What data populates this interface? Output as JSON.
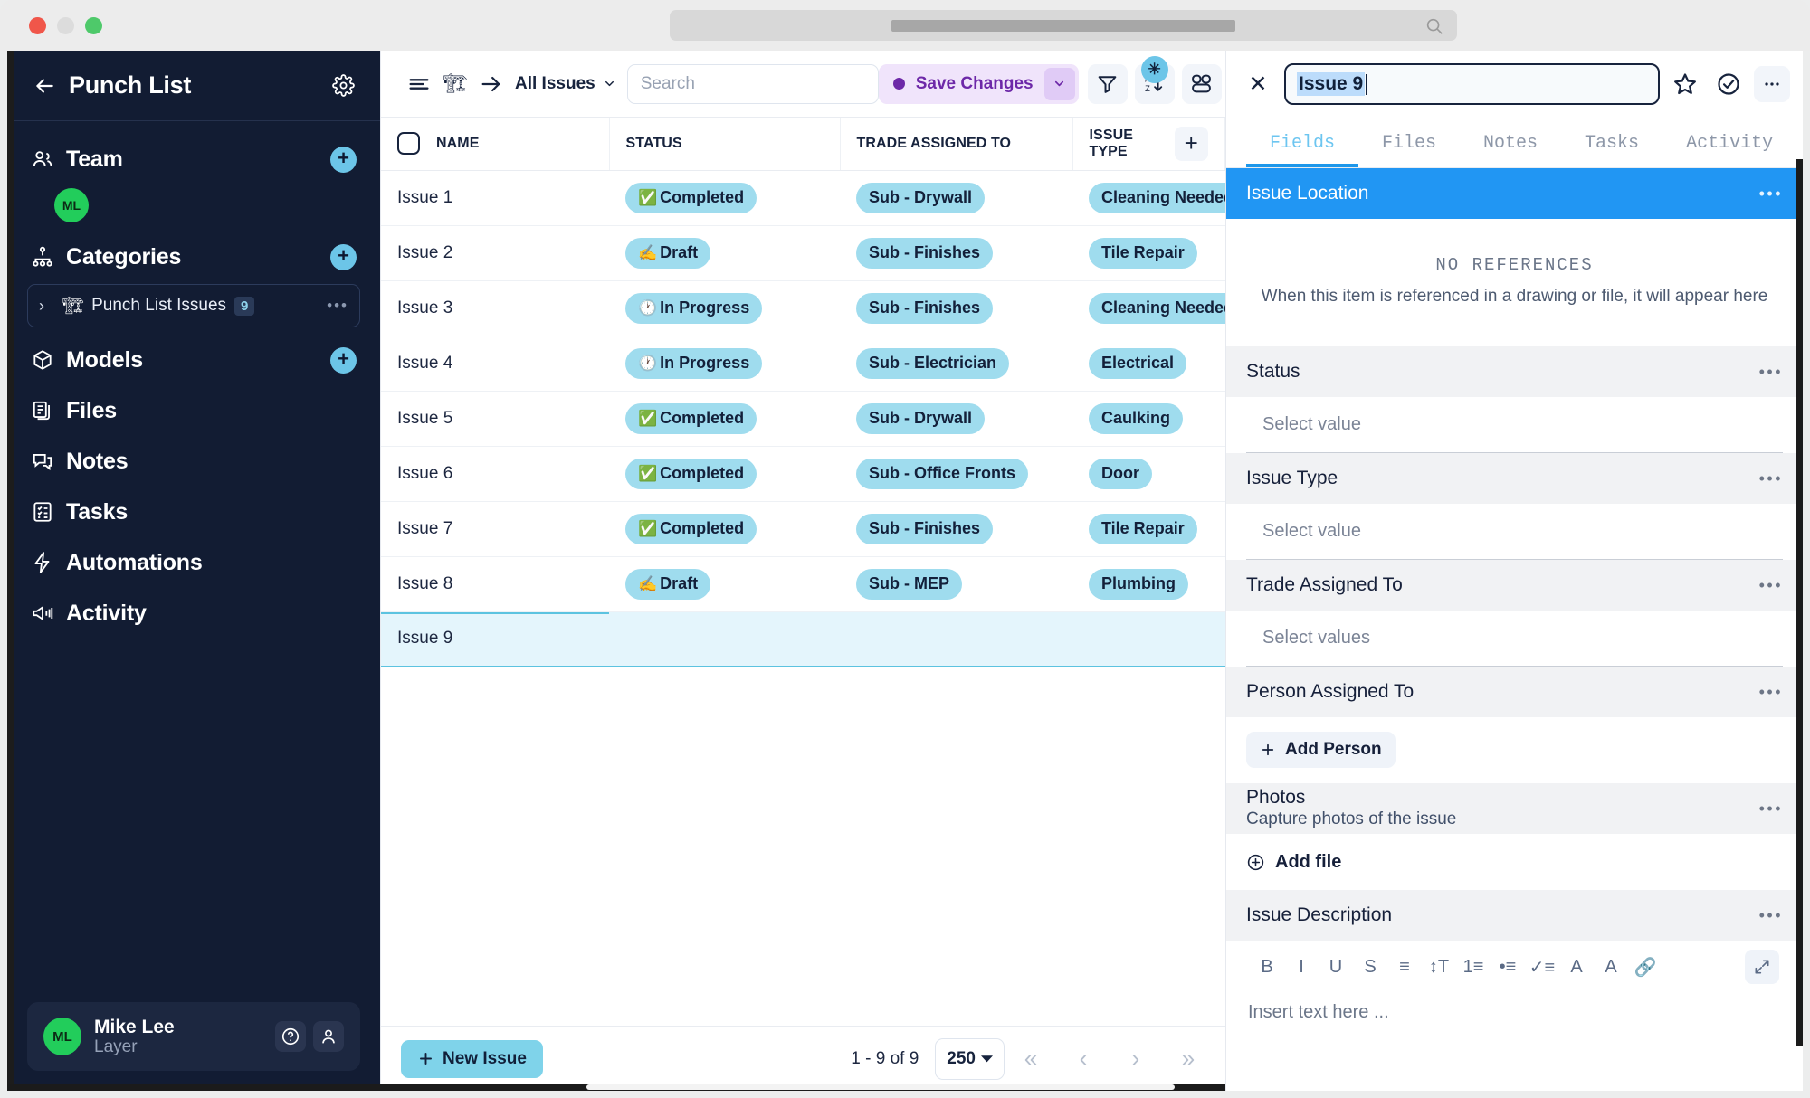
{
  "window": {
    "traffic_lights": [
      "close",
      "minimize",
      "maximize"
    ],
    "omnibox_placeholder": ""
  },
  "sidebar": {
    "back_icon": "arrow-left-icon",
    "title": "Punch List",
    "settings_icon": "gear-icon",
    "sections": [
      {
        "label": "Team",
        "icon": "people-icon",
        "has_add": true
      },
      {
        "label": "Categories",
        "icon": "hierarchy-icon",
        "has_add": true
      },
      {
        "label": "Models",
        "icon": "cube-icon",
        "has_add": true
      },
      {
        "label": "Files",
        "icon": "files-icon",
        "has_add": false
      },
      {
        "label": "Notes",
        "icon": "chat-icon",
        "has_add": false
      },
      {
        "label": "Tasks",
        "icon": "checklist-icon",
        "has_add": false
      },
      {
        "label": "Automations",
        "icon": "bolt-icon",
        "has_add": false
      },
      {
        "label": "Activity",
        "icon": "megaphone-icon",
        "has_add": false
      }
    ],
    "team_avatar": "ML",
    "category": {
      "chevron": "chevron-right-icon",
      "emoji": "🏗",
      "label": "Punch List Issues",
      "count": "9",
      "menu": "•••"
    },
    "user": {
      "initials": "ML",
      "name": "Mike Lee",
      "org": "Layer",
      "help_icon": "question-circle-icon",
      "account_icon": "person-icon"
    }
  },
  "toolbar": {
    "rows_icon": "rows-icon",
    "crane_emoji": "🏗",
    "arrow_icon": "arrow-right-icon",
    "view_label": "All Issues",
    "view_caret": "chevron-down-icon",
    "search_placeholder": "Search",
    "save_label": "Save Changes",
    "save_caret": "chevron-down-icon",
    "filter_icon": "filter-icon",
    "sort_icon": "sort-az-icon",
    "sort_badge": "✳",
    "group_icon": "group-icon",
    "more_icon": "more-horizontal-icon"
  },
  "table": {
    "columns": [
      "NAME",
      "STATUS",
      "TRADE ASSIGNED TO",
      "ISSUE TYPE"
    ],
    "add_column_icon": "plus-icon",
    "select_all_checkbox": false,
    "rows": [
      {
        "name": "Issue 1",
        "status": "Completed",
        "status_emoji": "✅",
        "trade": "Sub - Drywall",
        "type": "Cleaning Needed",
        "selected": false
      },
      {
        "name": "Issue 2",
        "status": "Draft",
        "status_emoji": "✍️",
        "trade": "Sub - Finishes",
        "type": "Tile Repair",
        "selected": false
      },
      {
        "name": "Issue 3",
        "status": "In Progress",
        "status_emoji": "🕐",
        "trade": "Sub - Finishes",
        "type": "Cleaning Needed",
        "selected": false
      },
      {
        "name": "Issue 4",
        "status": "In Progress",
        "status_emoji": "🕐",
        "trade": "Sub - Electrician",
        "type": "Electrical",
        "selected": false
      },
      {
        "name": "Issue 5",
        "status": "Completed",
        "status_emoji": "✅",
        "trade": "Sub - Drywall",
        "type": "Caulking",
        "selected": false
      },
      {
        "name": "Issue 6",
        "status": "Completed",
        "status_emoji": "✅",
        "trade": "Sub - Office Fronts",
        "type": "Door",
        "selected": false
      },
      {
        "name": "Issue 7",
        "status": "Completed",
        "status_emoji": "✅",
        "trade": "Sub - Finishes",
        "type": "Tile Repair",
        "selected": false
      },
      {
        "name": "Issue 8",
        "status": "Draft",
        "status_emoji": "✍️",
        "trade": "Sub - MEP",
        "type": "Plumbing",
        "selected": false
      },
      {
        "name": "Issue 9",
        "status": "",
        "status_emoji": "",
        "trade": "",
        "type": "",
        "selected": true
      }
    ]
  },
  "footer": {
    "new_issue_label": "New Issue",
    "new_issue_icon": "plus-icon",
    "count_text": "1 - 9 of 9",
    "page_size": "250",
    "page_size_caret": "caret-down-icon",
    "first_page_icon": "«",
    "prev_page_icon": "‹",
    "next_page_icon": "›",
    "last_page_icon": "»"
  },
  "detail": {
    "close_icon": "close-icon",
    "title_value": "Issue 9",
    "star_icon": "star-icon",
    "complete_icon": "check-circle-icon",
    "more_icon": "more-horizontal-icon",
    "tabs": [
      {
        "label": "Fields",
        "active": true
      },
      {
        "label": "Files",
        "active": false
      },
      {
        "label": "Notes",
        "active": false
      },
      {
        "label": "Tasks",
        "active": false
      },
      {
        "label": "Activity",
        "active": false
      }
    ],
    "fields": [
      {
        "label": "Issue Location",
        "accent": true,
        "menu": "•••",
        "empty_title": "NO REFERENCES",
        "empty_sub": "When this item is referenced in a drawing or file, it will appear here"
      },
      {
        "label": "Status",
        "accent": false,
        "menu": "•••",
        "placeholder": "Select value"
      },
      {
        "label": "Issue Type",
        "accent": false,
        "menu": "•••",
        "placeholder": "Select value"
      },
      {
        "label": "Trade Assigned To",
        "accent": false,
        "menu": "•••",
        "placeholder": "Select values"
      },
      {
        "label": "Person Assigned To",
        "accent": false,
        "menu": "•••",
        "button_label": "Add Person",
        "button_icon": "plus-icon"
      },
      {
        "label": "Photos",
        "sublabel": "Capture photos of the issue",
        "accent": false,
        "menu": "•••",
        "button_label": "Add file",
        "button_icon": "plus-circle-icon"
      },
      {
        "label": "Issue Description",
        "accent": false,
        "menu": "•••",
        "editor_placeholder": "Insert text here ..."
      }
    ],
    "editor_tools": [
      {
        "icon": "bold-icon",
        "glyph": "B"
      },
      {
        "icon": "italic-icon",
        "glyph": "I"
      },
      {
        "icon": "underline-icon",
        "glyph": "U"
      },
      {
        "icon": "strikethrough-icon",
        "glyph": "S"
      },
      {
        "icon": "align-icon",
        "glyph": "≡"
      },
      {
        "icon": "line-height-icon",
        "glyph": "↕T"
      },
      {
        "icon": "ordered-list-icon",
        "glyph": "1≡"
      },
      {
        "icon": "bullet-list-icon",
        "glyph": "•≡"
      },
      {
        "icon": "checklist-icon",
        "glyph": "✓≡"
      },
      {
        "icon": "text-color-icon",
        "glyph": "A"
      },
      {
        "icon": "highlight-icon",
        "glyph": "A"
      },
      {
        "icon": "link-icon",
        "glyph": "🔗"
      }
    ],
    "editor_expand_icon": "expand-icon"
  },
  "colors": {
    "sidebar_bg": "#121c33",
    "accent_blue": "#2196f3",
    "pill_cyan": "#9fdcee",
    "avatar_green": "#22cd5b",
    "save_purple": "#6d28a8",
    "selected_row": "#e4f5fc"
  }
}
